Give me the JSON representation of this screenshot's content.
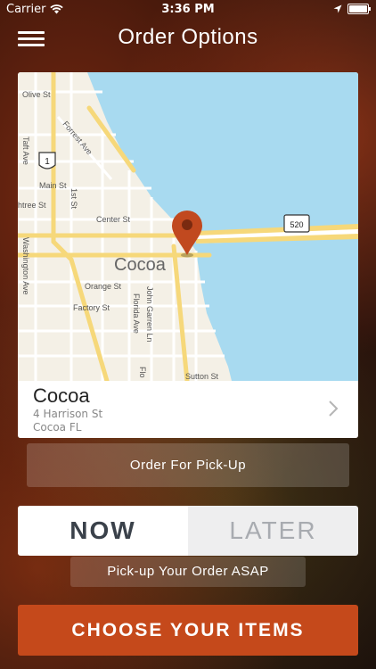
{
  "status_bar": {
    "carrier": "Carrier",
    "time": "3:36 PM"
  },
  "nav": {
    "title": "Order Options",
    "menu_icon": "hamburger-menu-icon"
  },
  "map": {
    "city_label": "Cocoa",
    "streets": {
      "olive": "Olive St",
      "forrest": "Forrest Ave",
      "taft": "Taft Ave",
      "main": "Main St",
      "first": "1st St",
      "peachtree": "htree St",
      "center": "Center St",
      "washington": "Washington Ave",
      "orange": "Orange St",
      "factory": "Factory St",
      "florida": "Florida Ave",
      "john_garren": "John Garren Ln",
      "flo": "Flo",
      "sutton": "Sutton St"
    },
    "shields": {
      "us1": "1",
      "sr520": "520"
    },
    "colors": {
      "water": "#a8daf0",
      "land": "#f4f0e6",
      "road": "#fbe9a6",
      "pin": "#c1491f"
    }
  },
  "location": {
    "name": "Cocoa",
    "address_line1": "4 Harrison St",
    "address_line2": "Cocoa FL"
  },
  "order_type": {
    "label": "Order For Pick-Up"
  },
  "timing": {
    "now_label": "NOW",
    "later_label": "LATER",
    "selected": "now",
    "description": "Pick-up Your Order ASAP"
  },
  "cta": {
    "label": "CHOOSE YOUR ITEMS",
    "color": "#c5491b"
  }
}
